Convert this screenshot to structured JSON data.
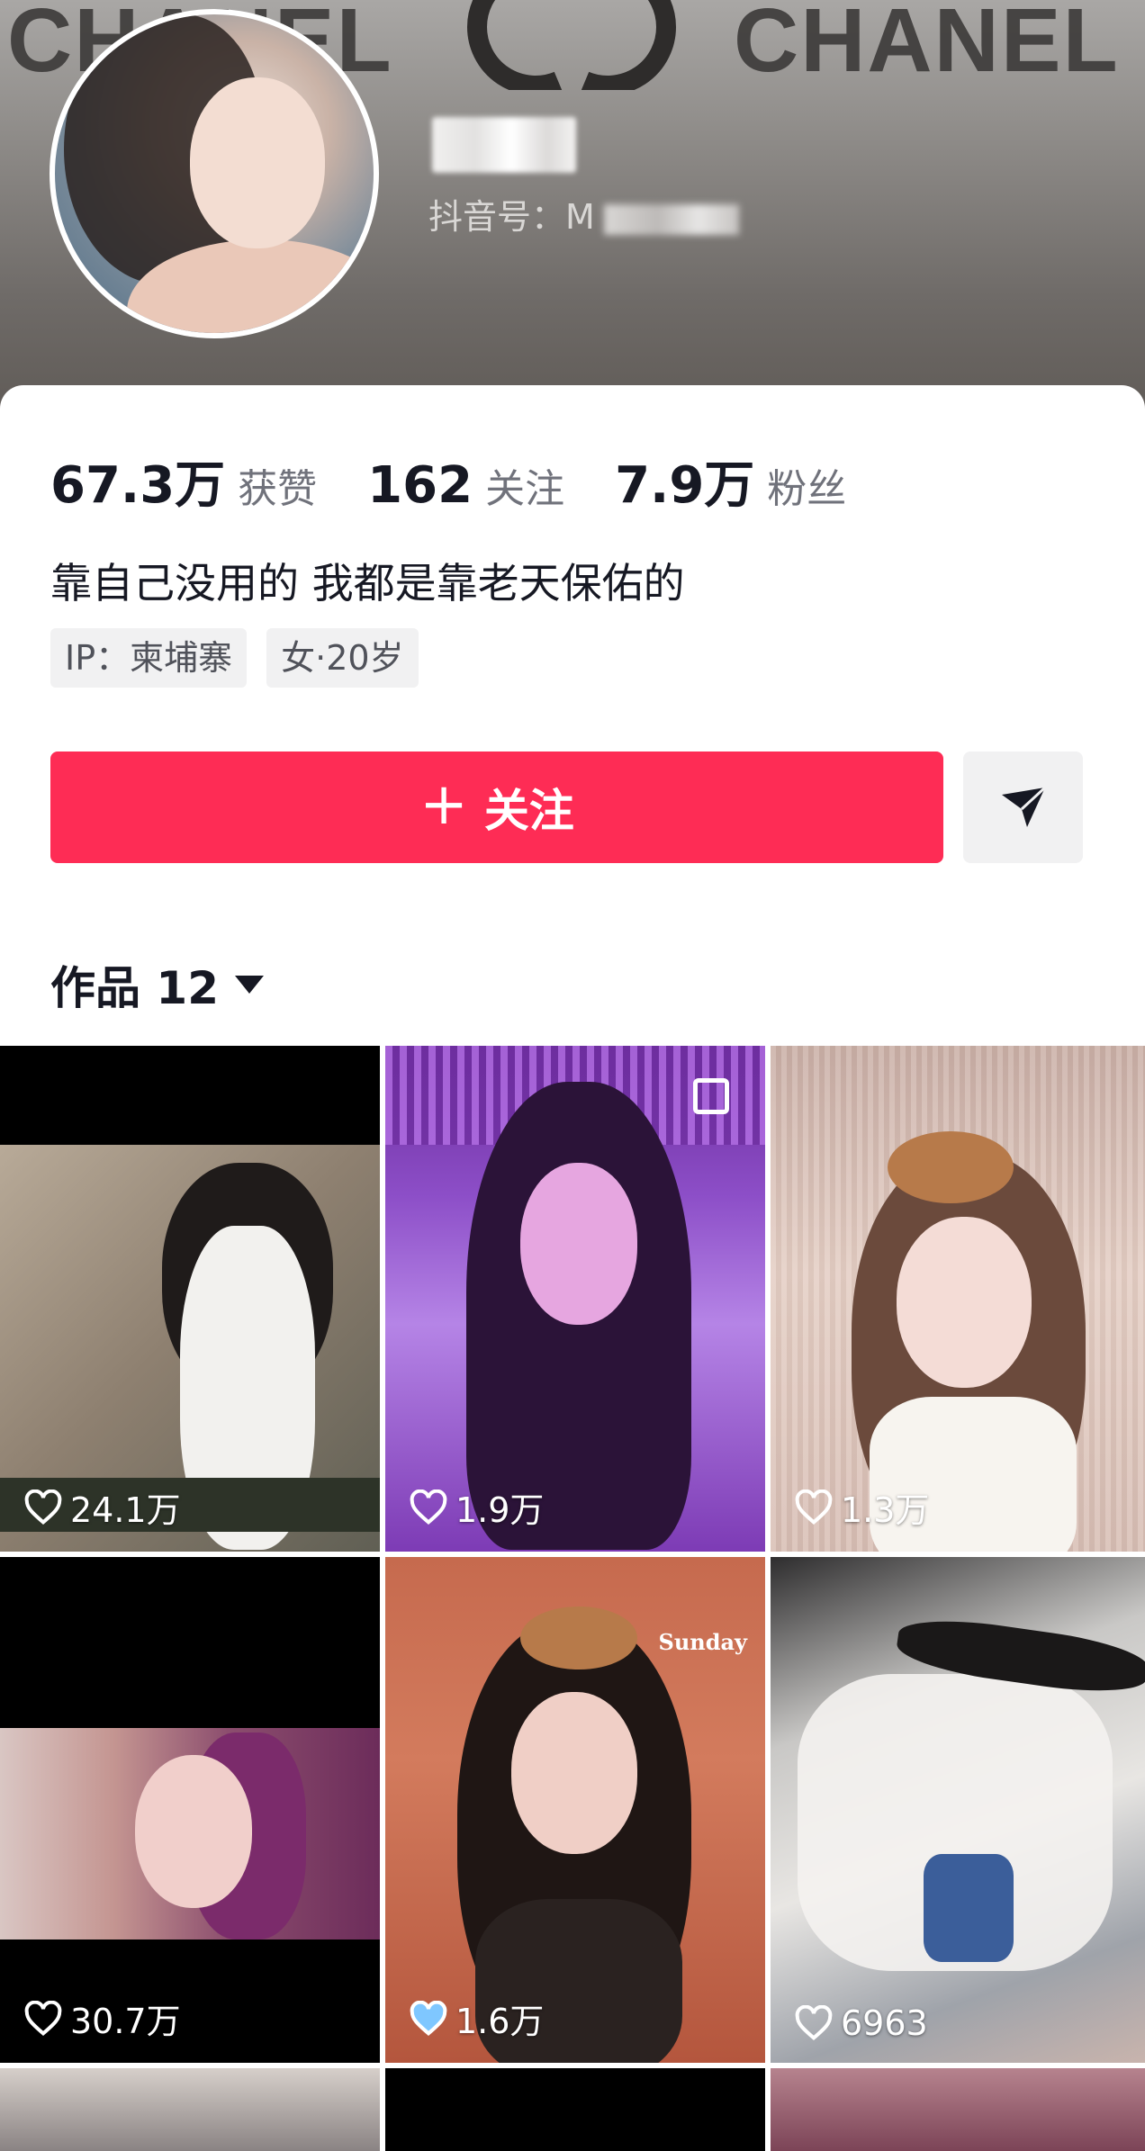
{
  "banner": {
    "left_text": "CHANEL",
    "right_text": "CHANEL",
    "logo_icon": "chanel-cc-logo"
  },
  "profile": {
    "id_label": "抖音号：M"
  },
  "stats": [
    {
      "value": "67.3万",
      "label": "获赞"
    },
    {
      "value": "162",
      "label": "关注"
    },
    {
      "value": "7.9万",
      "label": "粉丝"
    }
  ],
  "bio": "靠自己没用的 我都是靠老天保佑的",
  "tags": [
    "IP：柬埔寨",
    "女·20岁"
  ],
  "actions": {
    "follow_label": "关注",
    "follow_icon": "plus-icon",
    "share_icon": "send-arrow-icon",
    "accent_color": "#fe2c55"
  },
  "works_tab": {
    "label": "作品 12",
    "caret_icon": "caret-down-icon"
  },
  "videos": [
    {
      "likes": "24.1万"
    },
    {
      "likes": "1.9万"
    },
    {
      "likes": "1.3万"
    },
    {
      "likes": "30.7万"
    },
    {
      "likes": "1.6万"
    },
    {
      "likes": "6963"
    }
  ]
}
